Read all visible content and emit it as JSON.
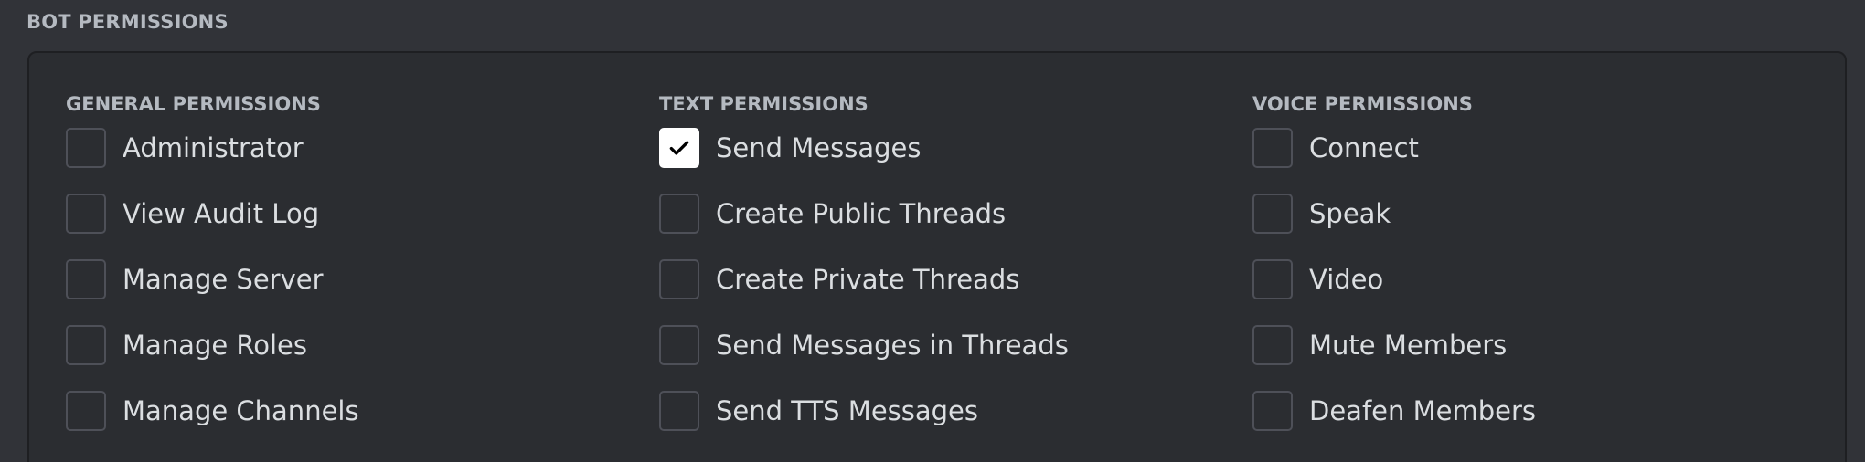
{
  "section_title": "BOT PERMISSIONS",
  "columns": [
    {
      "title": "GENERAL PERMISSIONS",
      "items": [
        {
          "label": "Administrator",
          "checked": false
        },
        {
          "label": "View Audit Log",
          "checked": false
        },
        {
          "label": "Manage Server",
          "checked": false
        },
        {
          "label": "Manage Roles",
          "checked": false
        },
        {
          "label": "Manage Channels",
          "checked": false
        }
      ]
    },
    {
      "title": "TEXT PERMISSIONS",
      "items": [
        {
          "label": "Send Messages",
          "checked": true
        },
        {
          "label": "Create Public Threads",
          "checked": false
        },
        {
          "label": "Create Private Threads",
          "checked": false
        },
        {
          "label": "Send Messages in Threads",
          "checked": false
        },
        {
          "label": "Send TTS Messages",
          "checked": false
        }
      ]
    },
    {
      "title": "VOICE PERMISSIONS",
      "items": [
        {
          "label": "Connect",
          "checked": false
        },
        {
          "label": "Speak",
          "checked": false
        },
        {
          "label": "Video",
          "checked": false
        },
        {
          "label": "Mute Members",
          "checked": false
        },
        {
          "label": "Deafen Members",
          "checked": false
        }
      ]
    }
  ],
  "colors": {
    "background": "#313338",
    "panel": "#2b2d31",
    "panel_border": "#1e1f22",
    "checkbox_border": "#4e5058",
    "checked_fill": "#ffffff",
    "heading": "#b5bac1",
    "text": "#dbdee1"
  },
  "icons": {
    "checked": "check-icon"
  }
}
